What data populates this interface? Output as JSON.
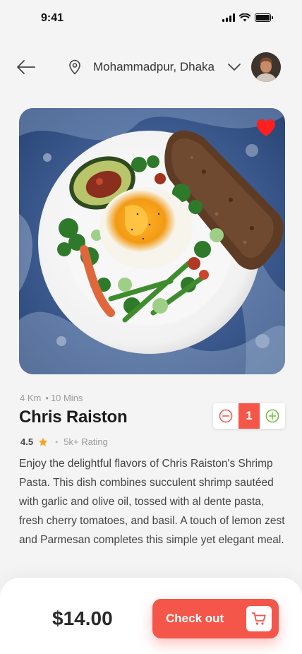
{
  "status_bar": {
    "time": "9:41"
  },
  "header": {
    "location": "Mohammadpur, Dhaka",
    "icons": {
      "back": "back-arrow-icon",
      "pin": "location-pin-icon",
      "dropdown": "chevron-down-icon",
      "avatar": "user-avatar"
    }
  },
  "dish": {
    "distance": "4 Km",
    "time": "10 Mins",
    "name": "Chris Raiston",
    "quantity": "1",
    "rating": "4.5",
    "rating_label": "5k+ Rating",
    "description": "Enjoy the delightful flavors of Chris Raiston's Shrimp Pasta. This dish combines succulent shrimp sautéed with garlic and olive oil, tossed with al dente pasta, fresh cherry tomatoes, and basil. A touch of lemon zest and Parmesan completes this simple yet elegant meal.",
    "favorite": true
  },
  "checkout": {
    "price": "$14.00",
    "button_label": "Check out"
  },
  "colors": {
    "accent": "#f4564a",
    "star": "#f6a623",
    "plus": "#6cbf3b"
  }
}
